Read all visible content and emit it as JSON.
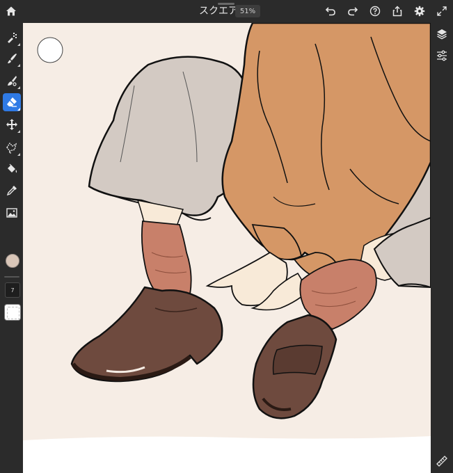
{
  "app": {
    "document_title": "スクエア",
    "zoom_level": "51%"
  },
  "top_toolbar": {
    "home_icon": "home-icon",
    "undo_icon": "undo-icon",
    "redo_icon": "redo-icon",
    "help_icon": "help-icon",
    "share_icon": "share-icon",
    "settings_icon": "gear-icon",
    "fullscreen_icon": "expand-icon"
  },
  "left_toolbar": {
    "tools": [
      {
        "name": "pixel-brush",
        "icon": "pixel-brush-icon",
        "active": false
      },
      {
        "name": "live-brush",
        "icon": "live-brush-icon",
        "active": false
      },
      {
        "name": "vector-brush",
        "icon": "vector-brush-icon",
        "active": false
      },
      {
        "name": "eraser",
        "icon": "eraser-icon",
        "active": true
      },
      {
        "name": "transform",
        "icon": "move-icon",
        "active": false
      },
      {
        "name": "lasso",
        "icon": "lasso-icon",
        "active": false
      },
      {
        "name": "fill",
        "icon": "fill-bucket-icon",
        "active": false
      },
      {
        "name": "eyedropper",
        "icon": "eyedropper-icon",
        "active": false
      },
      {
        "name": "image",
        "icon": "image-icon",
        "active": false
      }
    ],
    "current_color": "#d9c6b8",
    "brush_size": "7"
  },
  "right_toolbar": {
    "layers_icon": "layers-icon",
    "properties_icon": "sliders-icon",
    "ruler_icon": "ruler-icon"
  },
  "colors": {
    "chrome": "#2b2b2b",
    "accent": "#2f7ae5",
    "canvas_bg": "#f6ede5",
    "trousers": "#d3cac3",
    "sweater": "#d59766",
    "socks": "#c8806a",
    "shoes": "#6e4a3e",
    "skin": "#f8ead8"
  }
}
